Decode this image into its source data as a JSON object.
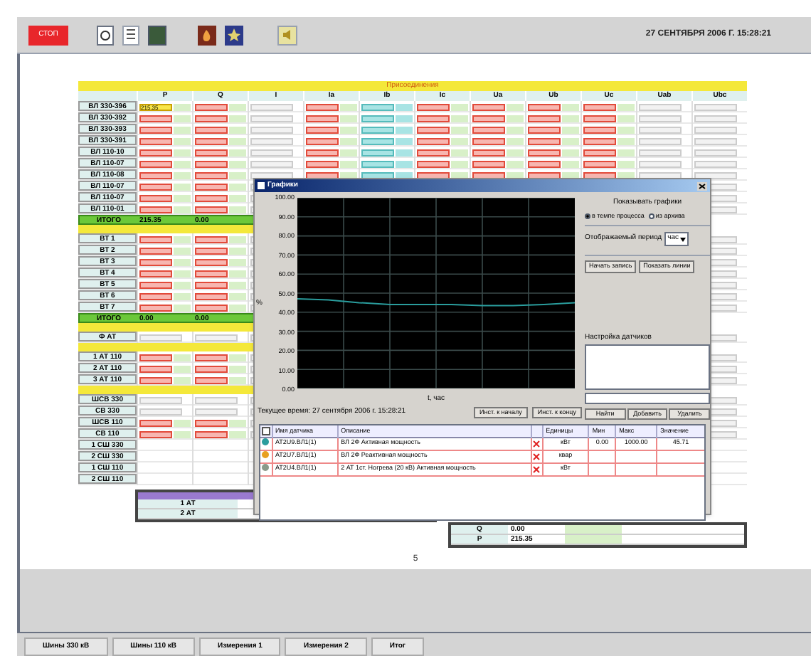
{
  "toolbar": {
    "stop_button": "СТОП",
    "datetime": "27 СЕНТЯБРЯ 2006 Г. 15:28:21"
  },
  "sheet": {
    "title": "Присоединения",
    "columns": [
      {
        "label": "P",
        "kind": "input"
      },
      {
        "label": "Q",
        "kind": "input"
      },
      {
        "label": "I",
        "kind": "reading"
      },
      {
        "label": "Ia",
        "kind": "input"
      },
      {
        "label": "Ib",
        "kind": "meter"
      },
      {
        "label": "Ic",
        "kind": "input"
      },
      {
        "label": "Ua",
        "kind": "input"
      },
      {
        "label": "Ub",
        "kind": "input"
      },
      {
        "label": "Uc",
        "kind": "input"
      },
      {
        "label": "Uab",
        "kind": "reading"
      },
      {
        "label": "Ubc",
        "kind": "reading"
      }
    ],
    "groups": [
      {
        "rows": [
          {
            "name": "ВЛ 330-396",
            "kind": "input",
            "p": "215.35"
          },
          {
            "name": "ВЛ 330-392",
            "kind": "input"
          },
          {
            "name": "ВЛ 330-393",
            "kind": "input"
          },
          {
            "name": "ВЛ 330-391",
            "kind": "input"
          },
          {
            "name": "ВЛ 110-10",
            "kind": "input"
          },
          {
            "name": "ВЛ 110-07",
            "kind": "input"
          },
          {
            "name": "ВЛ 110-08",
            "kind": "input"
          },
          {
            "name": "ВЛ 110-07",
            "kind": "input"
          },
          {
            "name": "ВЛ 110-07",
            "kind": "input"
          },
          {
            "name": "ВЛ 110-01",
            "kind": "input"
          }
        ],
        "total": {
          "label": "ИТОГО",
          "p": "215.35",
          "q": "0.00"
        }
      },
      {
        "rows": [
          {
            "name": "ВТ 1",
            "kind": "input"
          },
          {
            "name": "ВТ 2",
            "kind": "input"
          },
          {
            "name": "ВТ 3",
            "kind": "input"
          },
          {
            "name": "ВТ 4",
            "kind": "input"
          },
          {
            "name": "ВТ 5",
            "kind": "input"
          },
          {
            "name": "ВТ 6",
            "kind": "input"
          },
          {
            "name": "ВТ 7",
            "kind": "input"
          }
        ],
        "total": {
          "label": "ИТОГО",
          "p": "0.00",
          "q": "0.00"
        }
      },
      {
        "rows": [
          {
            "name": "Ф АТ",
            "kind": "reading"
          }
        ]
      },
      {
        "rows": [
          {
            "name": "1 АТ 110",
            "kind": "input"
          },
          {
            "name": "2 АТ 110",
            "kind": "input"
          },
          {
            "name": "3 АТ 110",
            "kind": "input"
          }
        ]
      },
      {
        "rows": [
          {
            "name": "ШСВ 330",
            "kind": "reading"
          },
          {
            "name": "СВ 330",
            "kind": "reading"
          },
          {
            "name": "ШСВ 110",
            "kind": "input"
          },
          {
            "name": "СВ 110",
            "kind": "input"
          },
          {
            "name": "1 СШ 330",
            "kind": "blank"
          },
          {
            "name": "2 СШ 330",
            "kind": "blank"
          },
          {
            "name": "1 СШ 110",
            "kind": "blank"
          },
          {
            "name": "2 СШ 110",
            "kind": "blank"
          }
        ]
      }
    ],
    "summary_left": [
      "1 АТ",
      "2 АТ"
    ],
    "summary_right": [
      {
        "label": "Q",
        "value": "0.00"
      },
      {
        "label": "P",
        "value": "215.35"
      }
    ],
    "page": "5"
  },
  "chart_window": {
    "title": "Графики",
    "chart_data": {
      "type": "line",
      "grid": true,
      "xlabel": "t, час",
      "ylabel": "%",
      "ylim": [
        0,
        100
      ],
      "yticks": [
        {
          "value": 0,
          "label": "0.00"
        },
        {
          "value": 10,
          "label": "10.00"
        },
        {
          "value": 20,
          "label": "20.00"
        },
        {
          "value": 30,
          "label": "30.00"
        },
        {
          "value": 40,
          "label": "40.00"
        },
        {
          "value": 50,
          "label": "50.00"
        },
        {
          "value": 60,
          "label": "60.00"
        },
        {
          "value": 70,
          "label": "70.00"
        },
        {
          "value": 80,
          "label": "80.00"
        },
        {
          "value": 90,
          "label": "90.00"
        },
        {
          "value": 100,
          "label": "100.00"
        }
      ],
      "series": [
        {
          "color": "#2a9d9d",
          "values": [
            47,
            46.5,
            45,
            44,
            44,
            44,
            43.5,
            43.5,
            44,
            45
          ]
        }
      ]
    },
    "time_label": "Текущее время: 27 сентября 2006 г. 15:28:21",
    "nav_buttons": [
      "Инст. к началу",
      "Инст. к концу"
    ],
    "show_label": "Показывать графики",
    "modes": [
      {
        "label": "в темпе процесса",
        "selected": true
      },
      {
        "label": "из архива",
        "selected": false
      }
    ],
    "period_label": "Отображаемый период",
    "period_value": "час",
    "actions": [
      "Начать запись",
      "Показать линии"
    ],
    "sensors_label": "Настройка датчиков",
    "sensor_buttons": [
      "Найти",
      "Добавить",
      "Удалить"
    ],
    "table": {
      "columns": [
        "Имя датчика",
        "Описание",
        "Единицы",
        "Мин",
        "Макс",
        "Значение"
      ],
      "rows": [
        {
          "color": "#2a9d9d",
          "name": "АТ2U9.ВЛ1(1)",
          "description": "ВЛ 2Ф Активная мощность",
          "unit": "кВт",
          "min": "0.00",
          "max": "1000.00",
          "value": "45.71"
        },
        {
          "color": "#e8a020",
          "name": "АТ2U7.ВЛ1(1)",
          "description": "ВЛ 2Ф Реактивная мощность",
          "unit": "квар"
        },
        {
          "color": "#8a9a8a",
          "name": "АТ2U4.ВЛ1(1)",
          "description": "2 АТ 1ст. Ногрева (20 кВ) Активная мощность",
          "unit": "кВт"
        }
      ]
    }
  },
  "tabs": [
    {
      "label": "Шины 330 кВ",
      "selected": false
    },
    {
      "label": "Шины 110 кВ",
      "selected": false
    },
    {
      "label": "Измерения 1",
      "selected": false
    },
    {
      "label": "Измерения 2",
      "selected": false
    },
    {
      "label": "Итог",
      "selected": false
    }
  ]
}
